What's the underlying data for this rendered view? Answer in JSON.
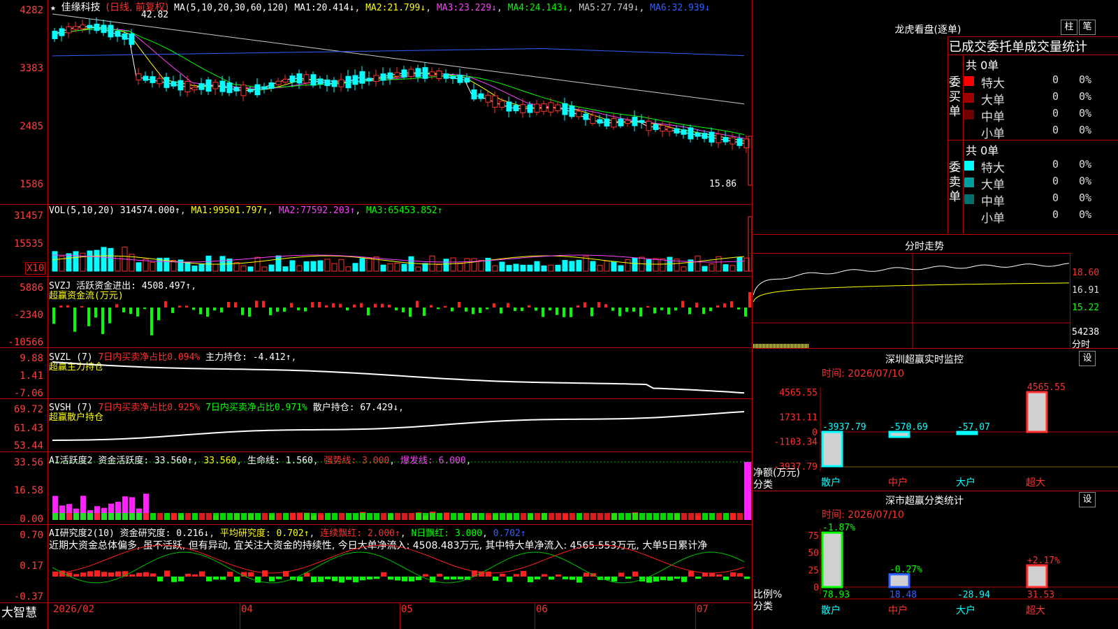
{
  "app": {
    "brand": "大智慧",
    "star_icon": "★",
    "stock_name": "佳缘科技",
    "period_label": "(日线, 前复权)"
  },
  "price_panel": {
    "ma_header": "MA(5,10,20,30,60,120)",
    "ma": [
      {
        "label": "MA1:",
        "value": "20.414↓",
        "color": "#ffffff"
      },
      {
        "label": "MA2:",
        "value": "21.799↓",
        "color": "#ffff00"
      },
      {
        "label": "MA3:",
        "value": "23.229↓",
        "color": "#ff40ff"
      },
      {
        "label": "MA4:",
        "value": "24.143↓",
        "color": "#00ff00"
      },
      {
        "label": "MA5:",
        "value": "27.749↓",
        "color": "#c8c8c8"
      },
      {
        "label": "MA6:",
        "value": "32.939↓",
        "color": "#3060ff"
      }
    ],
    "y_ticks": [
      "4282",
      "3383",
      "2485",
      "1586"
    ],
    "high_label": "42.82",
    "low_label": "15.86"
  },
  "vol_panel": {
    "header": "VOL(5,10,20)",
    "vol": "314574.000↑",
    "ma1_label": "MA1:",
    "ma1": "99501.797↑",
    "ma2_label": "MA2:",
    "ma2": "77592.203↑",
    "ma3_label": "MA3:",
    "ma3": "65453.852↑",
    "y_ticks": [
      "31457",
      "15535"
    ],
    "unit": "X10"
  },
  "svzj_panel": {
    "header": "SVZJ",
    "label": "活跃资金进出:",
    "value": "4508.497↑",
    "sub": "超赢资金流(万元)",
    "y_ticks": [
      "5886",
      "-2340",
      "-10566"
    ]
  },
  "svzl_panel": {
    "header": "SVZL (7)",
    "ratio": "7日内买卖净占比0.094%",
    "label": "主力持仓:",
    "value": "-4.412↑",
    "sub": "超赢主力持仓",
    "y_ticks": [
      "9.88",
      "1.41",
      "-7.06"
    ]
  },
  "svsh_panel": {
    "header": "SVSH (7)",
    "ratio1": "7日内买卖净占比0.925%",
    "ratio2": "7日内买卖净占比0.971%",
    "label": "散户持仓:",
    "value": "67.429↓",
    "sub": "超赢散户持仓",
    "y_ticks": [
      "69.72",
      "61.43",
      "53.44"
    ]
  },
  "ai_active": {
    "header": "AI活跃度2",
    "label": "资金活跃度:",
    "v1": "33.560↑",
    "v2": "33.560",
    "life_label": "生命线:",
    "life": "1.560",
    "strong": "强势线: 3.000",
    "burst": "爆发线: 6.000",
    "y_ticks": [
      "33.56",
      "16.58",
      "0.00"
    ]
  },
  "ai_research": {
    "header": "AI研究度2(10)",
    "label": "资金研究度:",
    "value": "0.216↓",
    "avg": "平均研究度: 0.702↑",
    "cont": "连续飘红: 2.000↑",
    "nday": "N日飘红: 3.000",
    "nday_v": "0.702↑",
    "comment": "近期大资金总体偏多, 虽不活跃, 但有异动, 宜关注大资金的持续性, 今日大单净流入: 4508.483万元, 其中特大单净流入: 4565.553万元, 大单5日累计净",
    "y_ticks": [
      "0.70",
      "0.17",
      "-0.37"
    ]
  },
  "x_axis": [
    "2026/02",
    "04",
    "05",
    "06",
    "07"
  ],
  "dragon_panel": {
    "title": "龙虎看盘(逐单)",
    "btn_bar": "柱",
    "btn_count": "笔",
    "subtitle": "已成交委托单成交量统计",
    "buy_label": "委买单",
    "sell_label": "委卖单",
    "buy_total": "共 0单",
    "sell_total": "共 0单",
    "buy_rows": [
      {
        "name": "特大",
        "value": "0",
        "pct": "0%",
        "color": "#ff0000"
      },
      {
        "name": "大单",
        "value": "0",
        "pct": "0%",
        "color": "#a00000"
      },
      {
        "name": "中单",
        "value": "0",
        "pct": "0%",
        "color": "#700000"
      },
      {
        "name": "小单",
        "value": "0",
        "pct": "0%",
        "color": ""
      }
    ],
    "sell_rows": [
      {
        "name": "特大",
        "value": "0",
        "pct": "0%",
        "color": "#00ffff"
      },
      {
        "name": "大单",
        "value": "0",
        "pct": "0%",
        "color": "#00a0a0"
      },
      {
        "name": "中单",
        "value": "0",
        "pct": "0%",
        "color": "#007070"
      },
      {
        "name": "小单",
        "value": "0",
        "pct": "0%",
        "color": ""
      }
    ]
  },
  "intraday_panel": {
    "title": "分时走势",
    "y_ticks": [
      "18.60",
      "16.91",
      "15.22"
    ],
    "vol_tick": "54238",
    "unit": "分时"
  },
  "monitor_panel": {
    "title": "深圳超赢实时监控",
    "btn": "设",
    "time": "时间: 2026/07/10",
    "y_ticks": [
      "4565.55",
      "1731.11",
      "0",
      "-1103.34",
      "-3937.79"
    ],
    "side_label": "净额(万元)",
    "side_label2": "分类",
    "categories": [
      "散户",
      "中户",
      "大户",
      "超大"
    ],
    "values": [
      -3937.79,
      -570.69,
      -57.07,
      4565.55
    ],
    "value_labels": [
      "-3937.79",
      "-570.69",
      "-57.07",
      "4565.55"
    ]
  },
  "class_panel": {
    "title": "深市超赢分类统计",
    "btn": "设",
    "time": "时间: 2026/07/10",
    "y_ticks": [
      "75",
      "50",
      "25",
      "0"
    ],
    "side_label": "比例%",
    "side_label2": "分类",
    "categories": [
      "散户",
      "中户",
      "大户",
      "超大"
    ],
    "values": [
      78.93,
      18.48,
      -28.94,
      31.53
    ],
    "top_labels": [
      "-1.87%",
      "-0.27%",
      "",
      "+2.17%"
    ]
  }
}
